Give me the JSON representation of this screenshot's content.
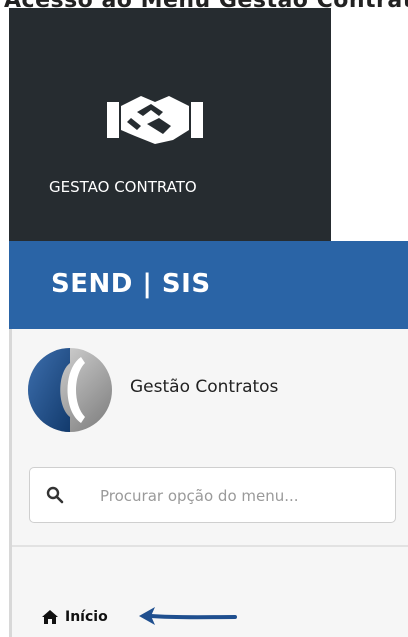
{
  "top_text": "Acesso ao Menu Gestão Contrato",
  "tile": {
    "icon": "handshake-icon",
    "label": "GESTAO CONTRATO"
  },
  "header": {
    "title": "SEND | SIS"
  },
  "sidebar": {
    "brand_name": "Gestão Contratos",
    "search": {
      "placeholder": "Procurar opção do menu...",
      "value": ""
    },
    "items": [
      {
        "label": "Início",
        "icon": "home-icon"
      }
    ]
  },
  "annotation": {
    "icon": "arrow-left-icon",
    "color": "#1f4f8f"
  },
  "colors": {
    "tile_bg": "#262c30",
    "header_bg": "#2a64a6",
    "sidebar_bg": "#f6f6f6"
  }
}
